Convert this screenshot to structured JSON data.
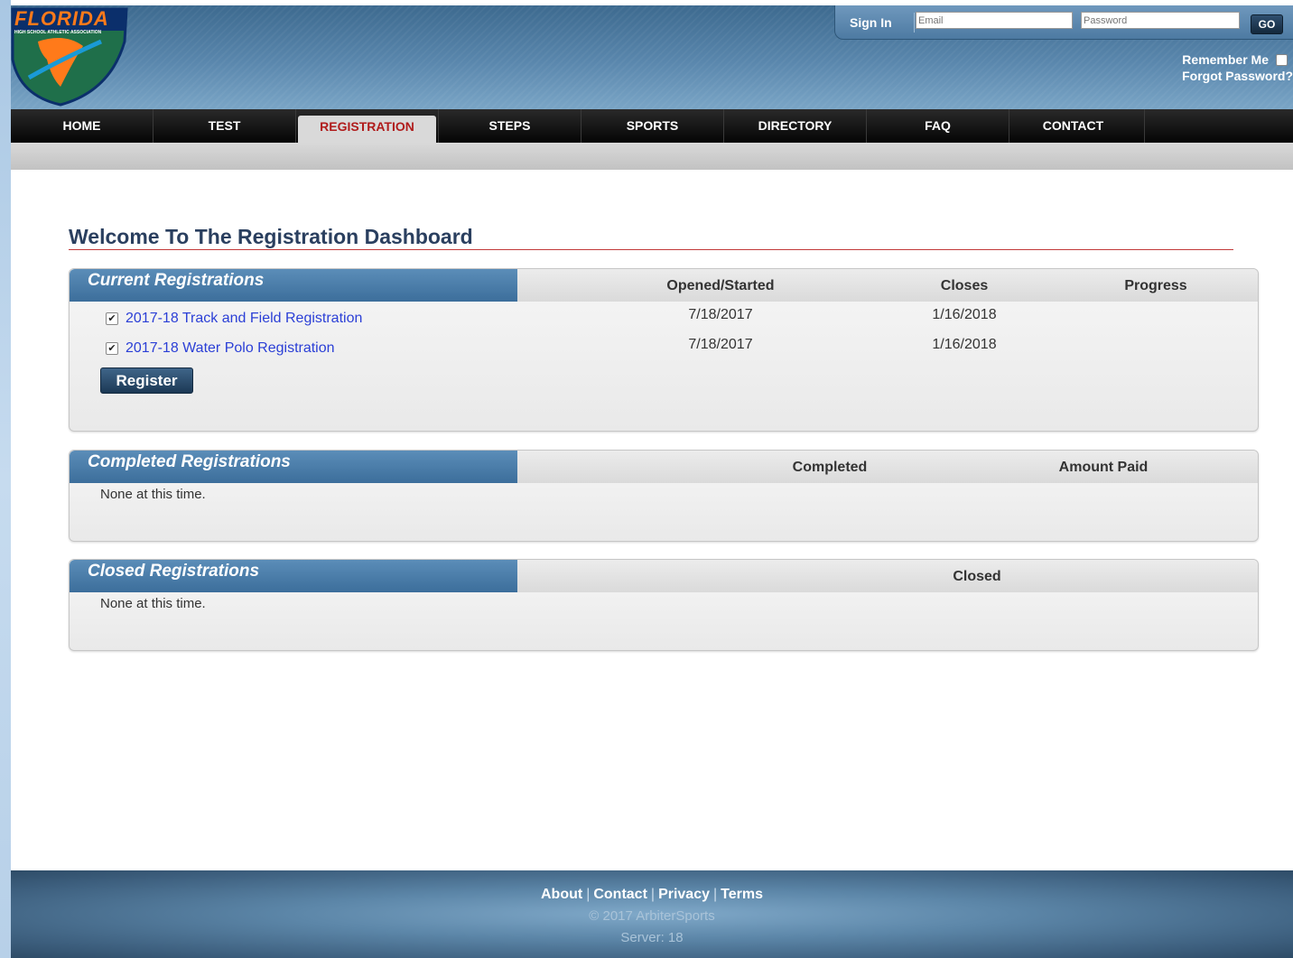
{
  "header": {
    "logo_text": "FLORIDA",
    "logo_subtext": "HIGH SCHOOL ATHLETIC ASSOCIATION",
    "signin_label": "Sign In",
    "email_placeholder": "Email",
    "password_placeholder": "Password",
    "go_label": "GO",
    "remember_label": "Remember Me",
    "forgot_label": "Forgot Password?"
  },
  "nav": {
    "items": [
      {
        "label": "HOME"
      },
      {
        "label": "TEST"
      },
      {
        "label": "REGISTRATION",
        "active": true
      },
      {
        "label": "STEPS"
      },
      {
        "label": "SPORTS"
      },
      {
        "label": "DIRECTORY"
      },
      {
        "label": "FAQ"
      },
      {
        "label": "CONTACT"
      }
    ]
  },
  "page": {
    "title": "Welcome To The Registration Dashboard"
  },
  "current": {
    "heading": "Current Registrations",
    "columns": [
      "Opened/Started",
      "Closes",
      "Progress"
    ],
    "rows": [
      {
        "name": "2017-18 Track and Field Registration",
        "opened": "7/18/2017",
        "closes": "1/16/2018",
        "checked": true
      },
      {
        "name": "2017-18 Water Polo Registration",
        "opened": "7/18/2017",
        "closes": "1/16/2018",
        "checked": true
      }
    ],
    "register_label": "Register"
  },
  "completed": {
    "heading": "Completed Registrations",
    "columns": [
      "Completed",
      "Amount Paid"
    ],
    "empty_text": "None at this time."
  },
  "closed": {
    "heading": "Closed Registrations",
    "columns": [
      "Closed"
    ],
    "empty_text": "None at this time."
  },
  "footer": {
    "links": [
      "About",
      "Contact",
      "Privacy",
      "Terms"
    ],
    "copyright": "© 2017 ArbiterSports",
    "server": "Server: 18"
  },
  "colors": {
    "header_blue": "#4d7aa2",
    "active_tab_text": "#b01c1c",
    "link_blue": "#2b3fd6",
    "panel_tab_blue": "#3c6e9b"
  }
}
